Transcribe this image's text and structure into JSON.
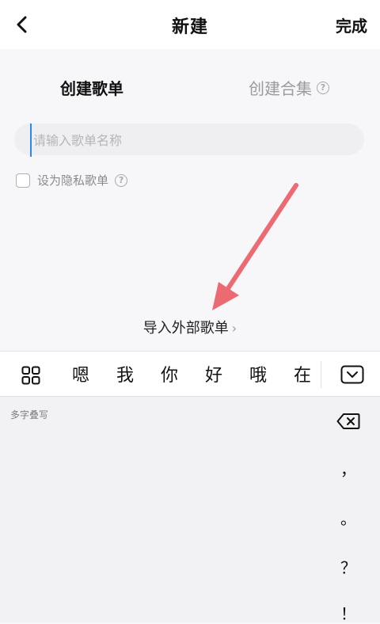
{
  "header": {
    "title": "新建",
    "done_label": "完成"
  },
  "tabs": {
    "create_playlist": "创建歌单",
    "create_collection": "创建合集"
  },
  "name_input": {
    "placeholder": "请输入歌单名称",
    "value": ""
  },
  "private_option": {
    "label": "设为隐私歌单",
    "checked": false
  },
  "import_link": {
    "label": "导入外部歌单",
    "chevron": "›"
  },
  "candidates": [
    "嗯",
    "我",
    "你",
    "好",
    "哦",
    "在"
  ],
  "keyboard": {
    "mode_label": "多字叠写",
    "punctuation": [
      "，",
      "。",
      "？",
      "！"
    ]
  },
  "colors": {
    "accent_cursor": "#2e86f5",
    "arrow_annotation": "#ec6b73"
  }
}
